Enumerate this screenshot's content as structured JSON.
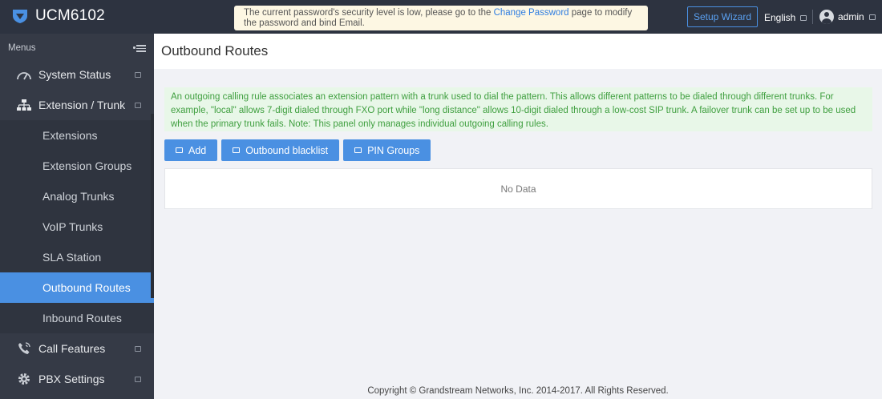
{
  "app": {
    "title": "UCM6102"
  },
  "notice": {
    "prefix": "The current password's security level is low, please go to the ",
    "link": "Change Password",
    "suffix": " page to modify the password and bind Email."
  },
  "header": {
    "setup_wizard": "Setup Wizard",
    "language": "English",
    "user": "admin"
  },
  "sidebar": {
    "heading": "Menus",
    "items": [
      {
        "label": "System Status",
        "icon": "gauge-icon",
        "type": "top"
      },
      {
        "label": "Extension / Trunk",
        "icon": "network-icon",
        "type": "top"
      },
      {
        "label": "Extensions",
        "type": "sub"
      },
      {
        "label": "Extension Groups",
        "type": "sub"
      },
      {
        "label": "Analog Trunks",
        "type": "sub"
      },
      {
        "label": "VoIP Trunks",
        "type": "sub"
      },
      {
        "label": "SLA Station",
        "type": "sub"
      },
      {
        "label": "Outbound Routes",
        "type": "sub",
        "active": true
      },
      {
        "label": "Inbound Routes",
        "type": "sub"
      },
      {
        "label": "Call Features",
        "icon": "phone-icon",
        "type": "top"
      },
      {
        "label": "PBX Settings",
        "icon": "gear-icon",
        "type": "top"
      }
    ]
  },
  "main": {
    "title": "Outbound Routes",
    "description": "An outgoing calling rule associates an extension pattern with a trunk used to dial the pattern. This allows different patterns to be dialed through different trunks. For example, \"local\" allows 7-digit dialed through FXO port while \"long distance\" allows 10-digit dialed through a low-cost SIP trunk. A failover trunk can be set up to be used when the primary trunk fails. Note: This panel only manages individual outgoing calling rules.",
    "buttons": {
      "add": "Add",
      "blacklist": "Outbound blacklist",
      "pin_groups": "PIN Groups"
    },
    "empty_text": "No Data"
  },
  "footer": {
    "copyright": "Copyright © Grandstream Networks, Inc. 2014-2017. All Rights Reserved."
  },
  "colors": {
    "topbar": "#2d3340",
    "sidebar": "#353a46",
    "accent": "#4a90e2",
    "info_bg": "#e8f7e8",
    "info_text": "#3f9f3f"
  }
}
